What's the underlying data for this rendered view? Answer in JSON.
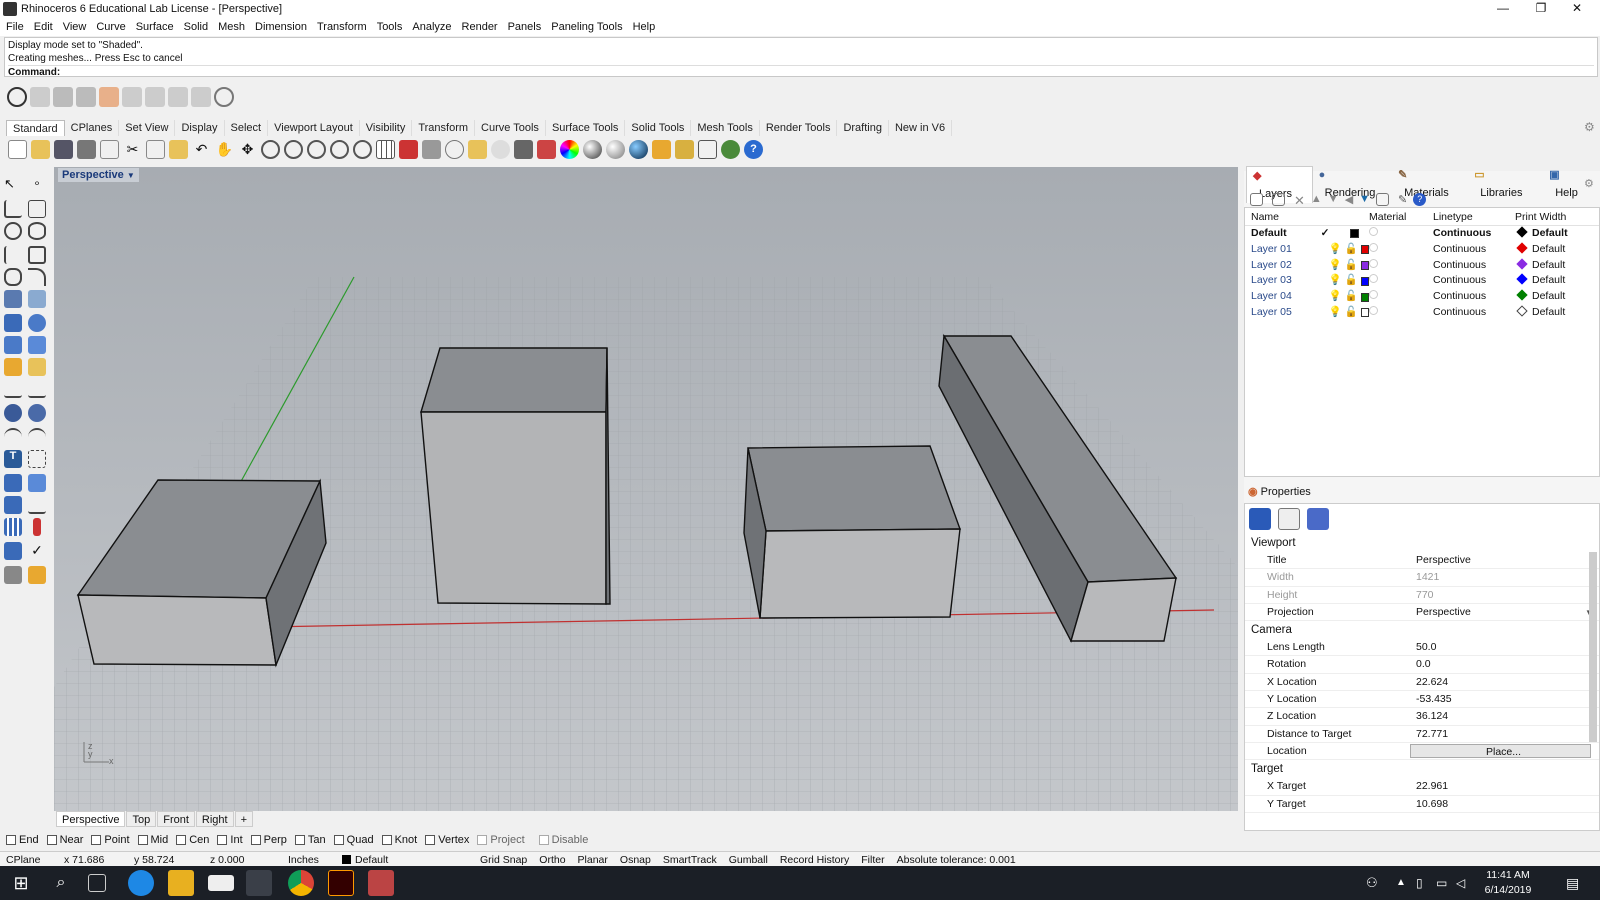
{
  "window": {
    "title": "Rhinoceros 6 Educational Lab License - [Perspective]",
    "minimize": "—",
    "restore": "❐",
    "close": "✕"
  },
  "menu": [
    "File",
    "Edit",
    "View",
    "Curve",
    "Surface",
    "Solid",
    "Mesh",
    "Dimension",
    "Transform",
    "Tools",
    "Analyze",
    "Render",
    "Panels",
    "Paneling Tools",
    "Help"
  ],
  "command_history": [
    "Display mode set to \"Shaded\".",
    "Creating meshes... Press Esc to cancel"
  ],
  "command_prompt": "Command:",
  "toolbar_tabs": [
    "Standard",
    "CPlanes",
    "Set View",
    "Display",
    "Select",
    "Viewport Layout",
    "Visibility",
    "Transform",
    "Curve Tools",
    "Surface Tools",
    "Solid Tools",
    "Mesh Tools",
    "Render Tools",
    "Drafting",
    "New in V6"
  ],
  "viewport": {
    "label": "Perspective",
    "tabs": [
      "Perspective",
      "Top",
      "Front",
      "Right"
    ],
    "add_tab": "+"
  },
  "osnaps": [
    "End",
    "Near",
    "Point",
    "Mid",
    "Cen",
    "Int",
    "Perp",
    "Tan",
    "Quad",
    "Knot",
    "Vertex",
    "Project",
    "Disable"
  ],
  "status": {
    "cplane": "CPlane",
    "x": "x 71.686",
    "y": "y 58.724",
    "z": "z 0.000",
    "units": "Inches",
    "layer": "Default",
    "grid_snap": "Grid Snap",
    "ortho": "Ortho",
    "planar": "Planar",
    "osnap": "Osnap",
    "smarttrack": "SmartTrack",
    "gumball": "Gumball",
    "record_history": "Record History",
    "filter": "Filter",
    "tolerance": "Absolute tolerance: 0.001"
  },
  "panel_tabs": [
    "Layers",
    "Rendering",
    "Materials",
    "Libraries",
    "Help"
  ],
  "layers": {
    "headers": [
      "Name",
      "Material",
      "Linetype",
      "Print Width"
    ],
    "rows": [
      {
        "name": "Default",
        "linetype": "Continuous",
        "print_width": "Default",
        "color": "#000000"
      },
      {
        "name": "Layer 01",
        "linetype": "Continuous",
        "print_width": "Default",
        "color": "#e00000"
      },
      {
        "name": "Layer 02",
        "linetype": "Continuous",
        "print_width": "Default",
        "color": "#8a2be2"
      },
      {
        "name": "Layer 03",
        "linetype": "Continuous",
        "print_width": "Default",
        "color": "#0000ff"
      },
      {
        "name": "Layer 04",
        "linetype": "Continuous",
        "print_width": "Default",
        "color": "#008000"
      },
      {
        "name": "Layer 05",
        "linetype": "Continuous",
        "print_width": "Default",
        "color": "#ffffff"
      }
    ]
  },
  "properties": {
    "title": "Properties",
    "viewport_section": "Viewport",
    "camera_section": "Camera",
    "target_section": "Target",
    "viewport_rows": [
      [
        "Title",
        "Perspective"
      ],
      [
        "Width",
        "1421"
      ],
      [
        "Height",
        "770"
      ],
      [
        "Projection",
        "Perspective"
      ]
    ],
    "camera_rows": [
      [
        "Lens Length",
        "50.0"
      ],
      [
        "Rotation",
        "0.0"
      ],
      [
        "X Location",
        "22.624"
      ],
      [
        "Y Location",
        "-53.435"
      ],
      [
        "Z Location",
        "36.124"
      ],
      [
        "Distance to Target",
        "72.771"
      ],
      [
        "Location",
        "Place..."
      ]
    ],
    "target_rows": [
      [
        "X Target",
        "22.961"
      ],
      [
        "Y Target",
        "10.698"
      ]
    ]
  },
  "clock": {
    "time": "11:41 AM",
    "date": "6/14/2019"
  }
}
